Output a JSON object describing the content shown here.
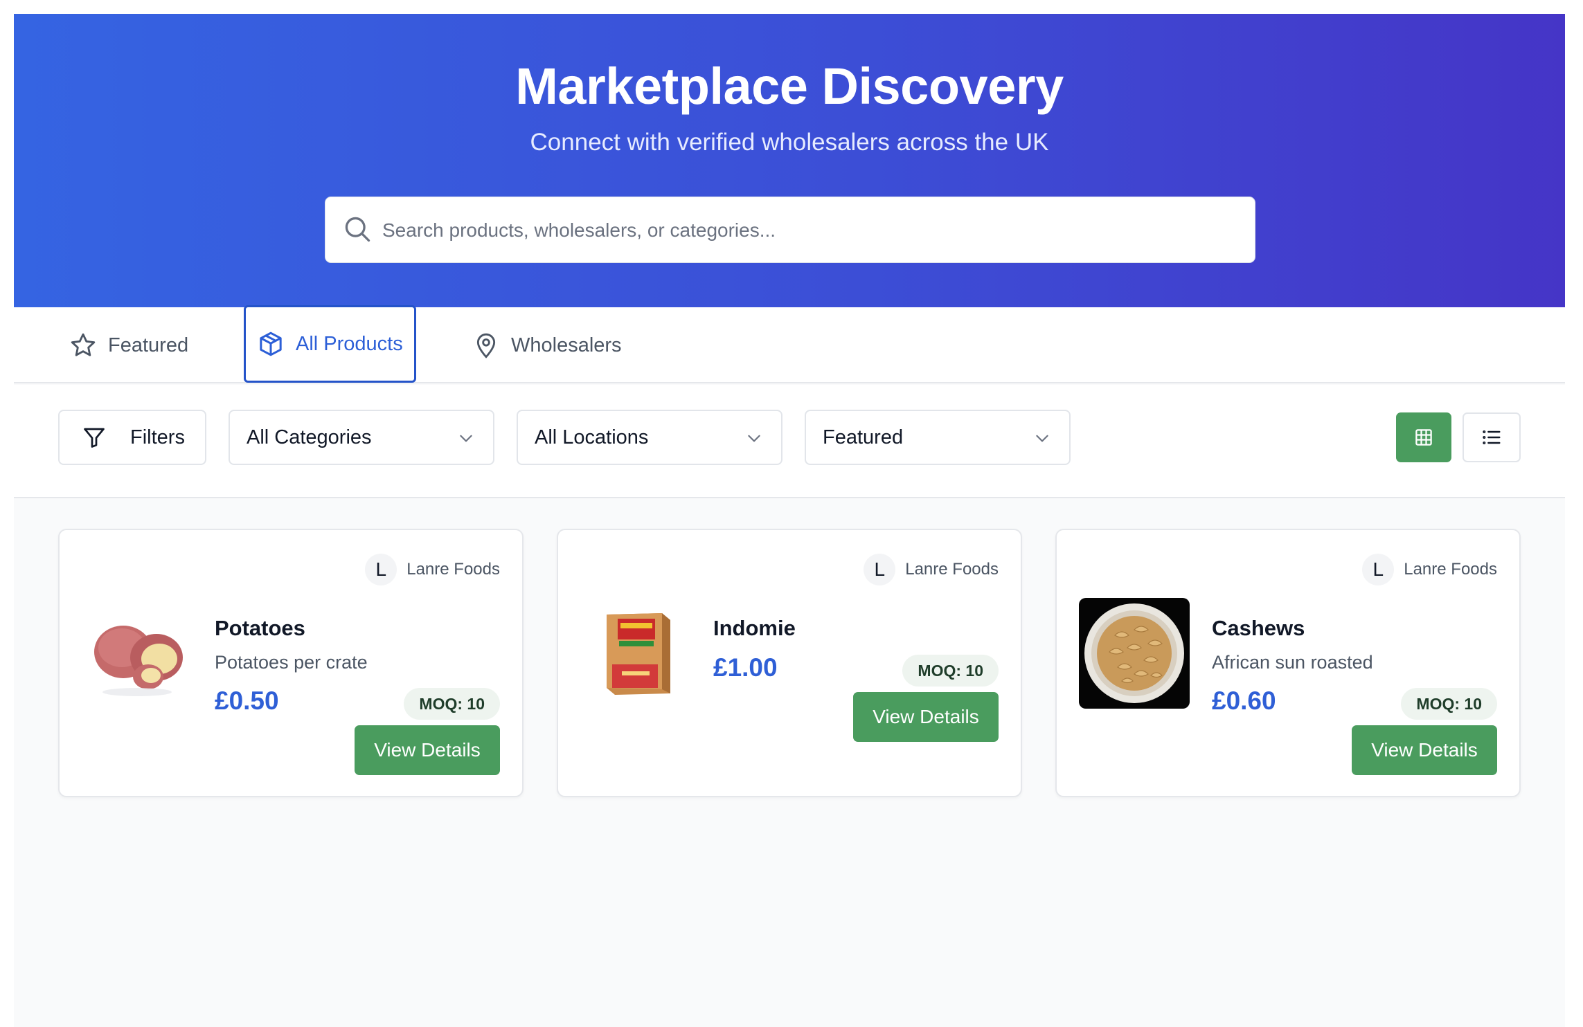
{
  "hero": {
    "title": "Marketplace Discovery",
    "subtitle": "Connect with verified wholesalers across the UK"
  },
  "search": {
    "placeholder": "Search products, wholesalers, or categories...",
    "value": "",
    "icon": "search-icon"
  },
  "tabs": [
    {
      "label": "Featured",
      "icon": "star-icon",
      "active": false
    },
    {
      "label": "All Products",
      "icon": "box-icon",
      "active": true
    },
    {
      "label": "Wholesalers",
      "icon": "map-pin-icon",
      "active": false
    }
  ],
  "filters": {
    "filters_label": "Filters",
    "category_select": "All Categories",
    "location_select": "All Locations",
    "sort_select": "Featured",
    "view_mode": "grid"
  },
  "products": [
    {
      "seller_initial": "L",
      "seller": "Lanre Foods",
      "name": "Potatoes",
      "description": "Potatoes per crate",
      "price": "£0.50",
      "moq": "MOQ: 10",
      "button": "View Details"
    },
    {
      "seller_initial": "L",
      "seller": "Lanre Foods",
      "name": "Indomie",
      "description": "",
      "price": "£1.00",
      "moq": "MOQ: 10",
      "button": "View Details"
    },
    {
      "seller_initial": "L",
      "seller": "Lanre Foods",
      "name": "Cashews",
      "description": "African sun roasted",
      "price": "£0.60",
      "moq": "MOQ: 10",
      "button": "View Details"
    }
  ],
  "colors": {
    "hero_start": "#3564e2",
    "hero_end": "#4535c7",
    "accent_blue": "#2f5fd6",
    "action_green": "#4a9c5e"
  }
}
